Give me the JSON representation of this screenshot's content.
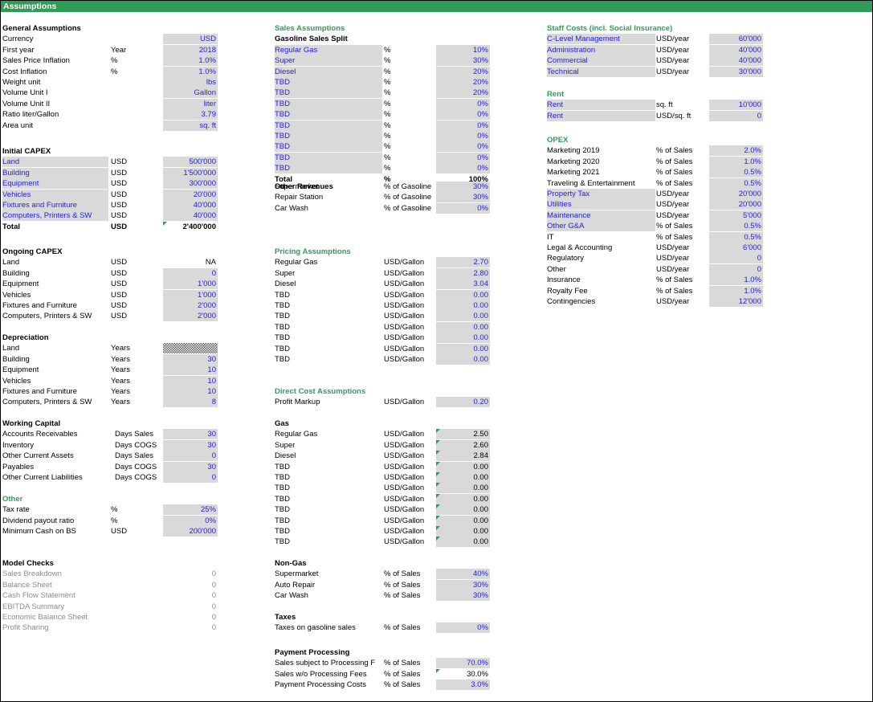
{
  "sheet": {
    "title": "Assumptions"
  },
  "general": {
    "title": "General Assumptions",
    "rows": [
      {
        "label": "Currency",
        "unit": "",
        "value": "USD"
      },
      {
        "label": "First year",
        "unit": "Year",
        "value": "2018"
      },
      {
        "label": "Sales Price Inflation",
        "unit": "%",
        "value": "1.0%"
      },
      {
        "label": "Cost Inflation",
        "unit": "%",
        "value": "1.0%"
      },
      {
        "label": "Weight unit",
        "unit": "",
        "value": "lbs"
      },
      {
        "label": "Volume Unit I",
        "unit": "",
        "value": "Gallon"
      },
      {
        "label": "Volume Unit II",
        "unit": "",
        "value": "liter"
      },
      {
        "label": "Ratio liter/Gallon",
        "unit": "",
        "value": "3.79"
      },
      {
        "label": "Area unit",
        "unit": "",
        "value": "sq. ft"
      }
    ]
  },
  "initial_capex": {
    "title": "Initial CAPEX",
    "rows": [
      {
        "label": "Land",
        "unit": "USD",
        "value": "500'000"
      },
      {
        "label": "Building",
        "unit": "USD",
        "value": "1'500'000"
      },
      {
        "label": "Equipment",
        "unit": "USD",
        "value": "300'000"
      },
      {
        "label": "Vehicles",
        "unit": "USD",
        "value": "20'000"
      },
      {
        "label": "Fixtures and Furniture",
        "unit": "USD",
        "value": "40'000"
      },
      {
        "label": "Computers, Printers & SW",
        "unit": "USD",
        "value": "40'000"
      }
    ],
    "total": {
      "label": "Total",
      "unit": "USD",
      "value": "2'400'000"
    }
  },
  "ongoing_capex": {
    "title": "Ongoing CAPEX",
    "rows": [
      {
        "label": "Land",
        "unit": "USD",
        "value": "NA"
      },
      {
        "label": "Building",
        "unit": "USD",
        "value": "0"
      },
      {
        "label": "Equipment",
        "unit": "USD",
        "value": "1'000"
      },
      {
        "label": "Vehicles",
        "unit": "USD",
        "value": "1'000"
      },
      {
        "label": "Fixtures and Furniture",
        "unit": "USD",
        "value": "2'000"
      },
      {
        "label": "Computers, Printers & SW",
        "unit": "USD",
        "value": "2'000"
      }
    ]
  },
  "depreciation": {
    "title": "Depreciation",
    "rows": [
      {
        "label": "Land",
        "unit": "Years",
        "value": ""
      },
      {
        "label": "Building",
        "unit": "Years",
        "value": "30"
      },
      {
        "label": "Equipment",
        "unit": "Years",
        "value": "10"
      },
      {
        "label": "Vehicles",
        "unit": "Years",
        "value": "10"
      },
      {
        "label": "Fixtures and Furniture",
        "unit": "Years",
        "value": "10"
      },
      {
        "label": "Computers, Printers & SW",
        "unit": "Years",
        "value": "8"
      }
    ]
  },
  "working_capital": {
    "title": "Working Capital",
    "rows": [
      {
        "label": "Accounts Receivables",
        "unit": "Days Sales",
        "value": "30"
      },
      {
        "label": "Inventory",
        "unit": "Days COGS",
        "value": "30"
      },
      {
        "label": "Other Current Assets",
        "unit": "Days Sales",
        "value": "0"
      },
      {
        "label": "Payables",
        "unit": "Days COGS",
        "value": "30"
      },
      {
        "label": "Other Current Liabilities",
        "unit": "Days COGS",
        "value": "0"
      }
    ]
  },
  "other": {
    "title": "Other",
    "rows": [
      {
        "label": "Tax rate",
        "unit": "%",
        "value": "25%"
      },
      {
        "label": "Dividend payout ratio",
        "unit": "%",
        "value": "0%"
      },
      {
        "label": "Minimum Cash on BS",
        "unit": "USD",
        "value": "200'000"
      }
    ]
  },
  "model_checks": {
    "title": "Model Checks",
    "rows": [
      {
        "label": "Sales Breakdown",
        "value": "0"
      },
      {
        "label": "Balance Sheet",
        "value": "0"
      },
      {
        "label": "Cash Flow Statement",
        "value": "0"
      },
      {
        "label": "EBITDA Summary",
        "value": "0"
      },
      {
        "label": "Economic Balance Sheet",
        "value": "0"
      },
      {
        "label": "Profit Sharing",
        "value": "0"
      }
    ]
  },
  "sales": {
    "title": "Sales Assumptions",
    "subtitle": "Gasoline Sales Split",
    "rows": [
      {
        "label": "Regular Gas",
        "unit": "%",
        "value": "10%"
      },
      {
        "label": "Super",
        "unit": "%",
        "value": "30%"
      },
      {
        "label": "Diesel",
        "unit": "%",
        "value": "20%"
      },
      {
        "label": "TBD",
        "unit": "%",
        "value": "20%"
      },
      {
        "label": "TBD",
        "unit": "%",
        "value": "20%"
      },
      {
        "label": "TBD",
        "unit": "%",
        "value": "0%"
      },
      {
        "label": "TBD",
        "unit": "%",
        "value": "0%"
      },
      {
        "label": "TBD",
        "unit": "%",
        "value": "0%"
      },
      {
        "label": "TBD",
        "unit": "%",
        "value": "0%"
      },
      {
        "label": "TBD",
        "unit": "%",
        "value": "0%"
      },
      {
        "label": "TBD",
        "unit": "%",
        "value": "0%"
      },
      {
        "label": "TBD",
        "unit": "%",
        "value": "0%"
      }
    ],
    "total": {
      "label": "Total",
      "unit": "%",
      "value": "100%"
    },
    "other_revenues_title": "Other Revenues",
    "other_revenues": [
      {
        "label": "Supermarket",
        "unit": "% of Gasoline",
        "value": "30%"
      },
      {
        "label": "Repair Station",
        "unit": "% of Gasoline",
        "value": "30%"
      },
      {
        "label": "Car Wash",
        "unit": "% of Gasoline",
        "value": "0%"
      }
    ]
  },
  "pricing": {
    "title": "Pricing Assumptions",
    "rows": [
      {
        "label": "Regular Gas",
        "unit": "USD/Gallon",
        "value": "2.70"
      },
      {
        "label": "Super",
        "unit": "USD/Gallon",
        "value": "2.80"
      },
      {
        "label": "Diesel",
        "unit": "USD/Gallon",
        "value": "3.04"
      },
      {
        "label": "TBD",
        "unit": "USD/Gallon",
        "value": "0.00"
      },
      {
        "label": "TBD",
        "unit": "USD/Gallon",
        "value": "0.00"
      },
      {
        "label": "TBD",
        "unit": "USD/Gallon",
        "value": "0.00"
      },
      {
        "label": "TBD",
        "unit": "USD/Gallon",
        "value": "0.00"
      },
      {
        "label": "TBD",
        "unit": "USD/Gallon",
        "value": "0.00"
      },
      {
        "label": "TBD",
        "unit": "USD/Gallon",
        "value": "0.00"
      },
      {
        "label": "TBD",
        "unit": "USD/Gallon",
        "value": "0.00"
      }
    ]
  },
  "direct_cost": {
    "title": "Direct Cost Assumptions",
    "rows": [
      {
        "label": "Profit Markup",
        "unit": "USD/Gallon",
        "value": "0.20"
      }
    ]
  },
  "gas": {
    "title": "Gas",
    "rows": [
      {
        "label": "Regular Gas",
        "unit": "USD/Gallon",
        "value": "2.50"
      },
      {
        "label": "Super",
        "unit": "USD/Gallon",
        "value": "2.60"
      },
      {
        "label": "Diesel",
        "unit": "USD/Gallon",
        "value": "2.84"
      },
      {
        "label": "TBD",
        "unit": "USD/Gallon",
        "value": "0.00"
      },
      {
        "label": "TBD",
        "unit": "USD/Gallon",
        "value": "0.00"
      },
      {
        "label": "TBD",
        "unit": "USD/Gallon",
        "value": "0.00"
      },
      {
        "label": "TBD",
        "unit": "USD/Gallon",
        "value": "0.00"
      },
      {
        "label": "TBD",
        "unit": "USD/Gallon",
        "value": "0.00"
      },
      {
        "label": "TBD",
        "unit": "USD/Gallon",
        "value": "0.00"
      },
      {
        "label": "TBD",
        "unit": "USD/Gallon",
        "value": "0.00"
      },
      {
        "label": "TBD",
        "unit": "USD/Gallon",
        "value": "0.00"
      }
    ]
  },
  "non_gas": {
    "title": "Non-Gas",
    "rows": [
      {
        "label": "Supermarket",
        "unit": "% of Sales",
        "value": "40%"
      },
      {
        "label": "Auto Repair",
        "unit": "% of Sales",
        "value": "30%"
      },
      {
        "label": "Car Wash",
        "unit": "% of Sales",
        "value": "30%"
      }
    ]
  },
  "taxes": {
    "title": "Taxes",
    "rows": [
      {
        "label": "Taxes on gasoline sales",
        "unit": "% of Sales",
        "value": "0%"
      }
    ]
  },
  "payment": {
    "title": "Payment Processing",
    "rows": [
      {
        "label": "Sales subject to Processing F",
        "unit": "% of Sales",
        "value": "70.0%"
      },
      {
        "label": "Sales w/o Processing Fees",
        "unit": "% of Sales",
        "value": "30.0%"
      },
      {
        "label": "Payment Processing Costs",
        "unit": "% of Sales",
        "value": "3.0%"
      }
    ]
  },
  "staff": {
    "title": "Staff Costs (incl. Social Insurance)",
    "rows": [
      {
        "label": "C-Level Management",
        "unit": "USD/year",
        "value": "60'000"
      },
      {
        "label": "Administration",
        "unit": "USD/year",
        "value": "40'000"
      },
      {
        "label": "Commercial",
        "unit": "USD/year",
        "value": "40'000"
      },
      {
        "label": "Technical",
        "unit": "USD/year",
        "value": "30'000"
      }
    ]
  },
  "rent": {
    "title": "Rent",
    "rows": [
      {
        "label": "Rent",
        "unit": "sq. ft",
        "value": "10'000"
      },
      {
        "label": "Rent",
        "unit": "USD/sq. ft",
        "value": "0"
      }
    ]
  },
  "opex": {
    "title": "OPEX",
    "rows": [
      {
        "label": "Marketing 2019",
        "unit": "% of Sales",
        "value": "2.0%"
      },
      {
        "label": "Marketing 2020",
        "unit": "% of Sales",
        "value": "1.0%"
      },
      {
        "label": "Marketing 2021",
        "unit": "% of Sales",
        "value": "0.5%"
      },
      {
        "label": "Traveling  & Entertainment",
        "unit": "% of Sales",
        "value": "0.5%"
      },
      {
        "label": "Property Tax",
        "unit": "USD/year",
        "value": "20'000"
      },
      {
        "label": "Utilities",
        "unit": "USD/year",
        "value": "20'000"
      },
      {
        "label": "Maintenance",
        "unit": "USD/year",
        "value": "5'000"
      },
      {
        "label": "Other G&A",
        "unit": "% of Sales",
        "value": "0.5%"
      },
      {
        "label": "IT",
        "unit": "% of Sales",
        "value": "0.5%"
      },
      {
        "label": "Legal & Accounting",
        "unit": "USD/year",
        "value": "6'000"
      },
      {
        "label": "Regulatory",
        "unit": "USD/year",
        "value": "0"
      },
      {
        "label": "Other",
        "unit": "USD/year",
        "value": "0"
      },
      {
        "label": "Insurance",
        "unit": "% of Sales",
        "value": "1.0%"
      },
      {
        "label": "Royalty Fee",
        "unit": "% of Sales",
        "value": "1.0%"
      },
      {
        "label": "Contingencies",
        "unit": "USD/year",
        "value": "12'000"
      }
    ]
  }
}
